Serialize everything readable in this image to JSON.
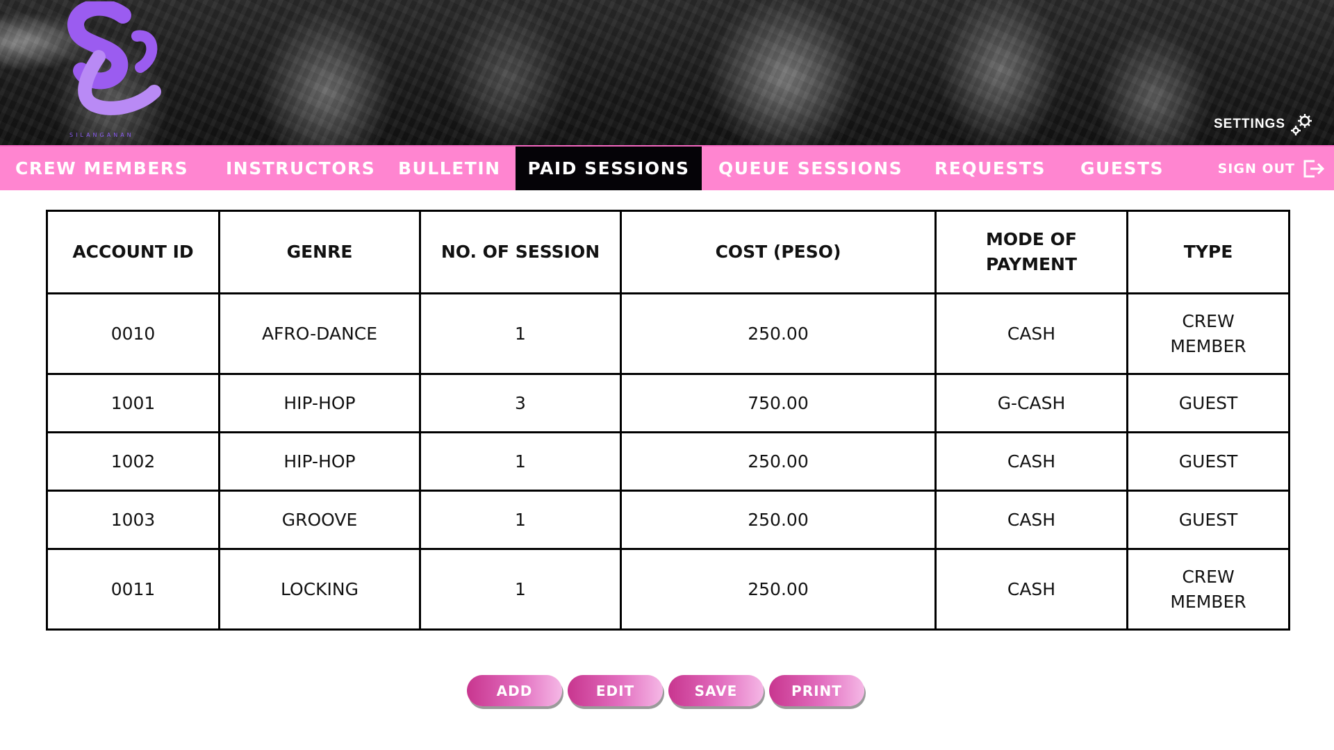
{
  "header": {
    "logo_caption": "SILANGANAN",
    "settings_label": "SETTINGS"
  },
  "nav": {
    "items": [
      {
        "label": "CREW MEMBERS"
      },
      {
        "label": "INSTRUCTORS"
      },
      {
        "label": "BULLETIN"
      },
      {
        "label": "PAID SESSIONS"
      },
      {
        "label": "QUEUE SESSIONS"
      },
      {
        "label": "REQUESTS"
      },
      {
        "label": "GUESTS"
      }
    ],
    "active": "PAID SESSIONS",
    "sign_out_label": "SIGN OUT"
  },
  "table": {
    "headers": [
      "ACCOUNT ID",
      "GENRE",
      "NO. OF SESSION",
      "COST (PESO)",
      "MODE OF PAYMENT",
      "TYPE"
    ],
    "rows": [
      [
        "0010",
        "AFRO-DANCE",
        "1",
        "250.00",
        "CASH",
        "CREW MEMBER"
      ],
      [
        "1001",
        "HIP-HOP",
        "3",
        "750.00",
        "G-CASH",
        "GUEST"
      ],
      [
        "1002",
        "HIP-HOP",
        "1",
        "250.00",
        "CASH",
        "GUEST"
      ],
      [
        "1003",
        "GROOVE",
        "1",
        "250.00",
        "CASH",
        "GUEST"
      ],
      [
        "0011",
        "LOCKING",
        "1",
        "250.00",
        "CASH",
        "CREW MEMBER"
      ]
    ]
  },
  "actions": {
    "add_label": "ADD",
    "edit_label": "EDIT",
    "save_label": "SAVE",
    "print_label": "PRINT"
  },
  "colors": {
    "nav_pink": "#ff85d0",
    "active_tab": "#050307",
    "logo_purple": "#9b5cf0",
    "button_pink": "#c8368f"
  },
  "icons": {
    "settings": "gear-icon",
    "sign_out": "sign-out-icon"
  }
}
